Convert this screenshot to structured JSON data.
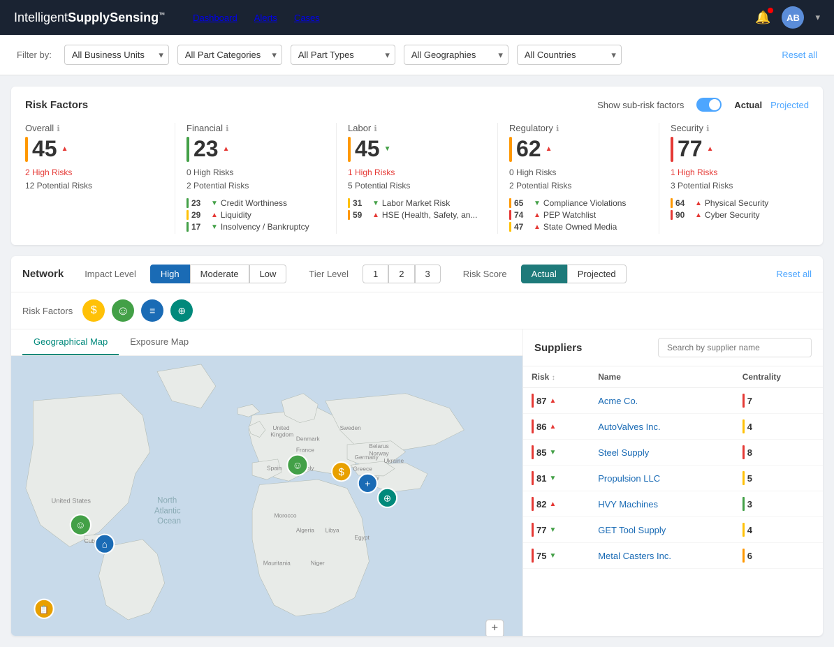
{
  "brand": {
    "name_light": "Intelligent",
    "name_bold": "SupplySensing",
    "tm": "™"
  },
  "nav": {
    "items": [
      {
        "label": "Dashboard",
        "active": true
      },
      {
        "label": "Alerts",
        "active": false
      },
      {
        "label": "Cases",
        "active": false
      }
    ]
  },
  "user": {
    "initials": "AB"
  },
  "filter_bar": {
    "label": "Filter by:",
    "filters": [
      {
        "id": "business-units",
        "value": "All Business Units"
      },
      {
        "id": "part-categories",
        "value": "All Part Categories"
      },
      {
        "id": "part-types",
        "value": "All Part Types"
      },
      {
        "id": "geographies",
        "value": "All Geographies"
      },
      {
        "id": "countries",
        "value": "All Countries"
      }
    ],
    "reset_label": "Reset all"
  },
  "risk_factors": {
    "title": "Risk Factors",
    "show_sub_label": "Show sub-risk factors",
    "actual_label": "Actual",
    "projected_label": "Projected",
    "columns": [
      {
        "id": "overall",
        "title": "Overall",
        "score": "45",
        "trend": "up",
        "bar_color": "orange",
        "high_risks": "2 High Risks",
        "potential_risks": "12 Potential Risks",
        "sub_items": []
      },
      {
        "id": "financial",
        "title": "Financial",
        "score": "23",
        "trend": "up",
        "bar_color": "green",
        "high_risks": "0 High Risks",
        "potential_risks": "2 Potential Risks",
        "sub_items": [
          {
            "score": "23",
            "trend": "down",
            "label": "Credit Worthiness",
            "bar_color": "green"
          },
          {
            "score": "29",
            "trend": "up",
            "label": "Liquidity",
            "bar_color": "yellow"
          },
          {
            "score": "17",
            "trend": "down",
            "label": "Insolvency / Bankruptcy",
            "bar_color": "green"
          }
        ]
      },
      {
        "id": "labor",
        "title": "Labor",
        "score": "45",
        "trend": "down",
        "bar_color": "orange",
        "high_risks": "1 High Risks",
        "potential_risks": "5 Potential Risks",
        "sub_items": [
          {
            "score": "31",
            "trend": "down",
            "label": "Labor Market Risk",
            "bar_color": "yellow"
          },
          {
            "score": "59",
            "trend": "up",
            "label": "HSE (Health, Safety, an...",
            "bar_color": "orange"
          },
          {
            "score": "",
            "trend": "",
            "label": "",
            "bar_color": ""
          }
        ]
      },
      {
        "id": "regulatory",
        "title": "Regulatory",
        "score": "62",
        "trend": "up",
        "bar_color": "orange",
        "high_risks": "0 High Risks",
        "potential_risks": "2 Potential Risks",
        "sub_items": [
          {
            "score": "65",
            "trend": "down",
            "label": "Compliance Violations",
            "bar_color": "orange"
          },
          {
            "score": "74",
            "trend": "up",
            "label": "PEP Watchlist",
            "bar_color": "red"
          },
          {
            "score": "47",
            "trend": "up",
            "label": "State Owned Media",
            "bar_color": "yellow"
          }
        ]
      },
      {
        "id": "security",
        "title": "Security",
        "score": "77",
        "trend": "up",
        "bar_color": "red",
        "high_risks": "1 High Risks",
        "potential_risks": "3 Potential Risks",
        "sub_items": [
          {
            "score": "64",
            "trend": "up",
            "label": "Physical Security",
            "bar_color": "orange"
          },
          {
            "score": "90",
            "trend": "up",
            "label": "Cyber Security",
            "bar_color": "red"
          }
        ]
      }
    ]
  },
  "network": {
    "title": "Network",
    "impact_label": "Impact Level",
    "impact_btns": [
      {
        "label": "High",
        "active": true
      },
      {
        "label": "Moderate",
        "active": false
      },
      {
        "label": "Low",
        "active": false
      }
    ],
    "tier_label": "Tier Level",
    "tier_btns": [
      {
        "label": "1",
        "active": false
      },
      {
        "label": "2",
        "active": false
      },
      {
        "label": "3",
        "active": false
      }
    ],
    "risk_score_label": "Risk Score",
    "risk_score_btns": [
      {
        "label": "Actual",
        "active": true
      },
      {
        "label": "Projected",
        "active": false
      }
    ],
    "reset_label": "Reset all"
  },
  "risk_factor_icons": {
    "label": "Risk Factors",
    "icons": [
      {
        "symbol": "$",
        "color": "yellow",
        "name": "financial-icon"
      },
      {
        "symbol": "☺",
        "color": "green",
        "name": "labor-icon"
      },
      {
        "symbol": "≡",
        "color": "blue",
        "name": "regulatory-icon"
      },
      {
        "symbol": "⊕",
        "color": "teal",
        "name": "security-icon"
      }
    ]
  },
  "map_tabs": [
    {
      "label": "Geographical Map",
      "active": true
    },
    {
      "label": "Exposure Map",
      "active": false
    }
  ],
  "suppliers": {
    "title": "Suppliers",
    "search_placeholder": "Search by supplier name",
    "col_risk": "Risk",
    "col_name": "Name",
    "col_centrality": "Centrality",
    "rows": [
      {
        "risk": 87,
        "trend": "up",
        "bar_color": "red",
        "name": "Acme Co.",
        "centrality": 7,
        "cen_color": "red"
      },
      {
        "risk": 86,
        "trend": "up",
        "bar_color": "red",
        "name": "AutoValves Inc.",
        "centrality": 4,
        "cen_color": "yellow"
      },
      {
        "risk": 85,
        "trend": "down",
        "bar_color": "red",
        "name": "Steel Supply",
        "centrality": 8,
        "cen_color": "red"
      },
      {
        "risk": 81,
        "trend": "down",
        "bar_color": "red",
        "name": "Propulsion LLC",
        "centrality": 5,
        "cen_color": "yellow"
      },
      {
        "risk": 82,
        "trend": "up",
        "bar_color": "red",
        "name": "HVY Machines",
        "centrality": 3,
        "cen_color": "green"
      },
      {
        "risk": 77,
        "trend": "down",
        "bar_color": "red",
        "name": "GET Tool Supply",
        "centrality": 4,
        "cen_color": "yellow"
      },
      {
        "risk": 75,
        "trend": "down",
        "bar_color": "red",
        "name": "Metal Casters Inc.",
        "centrality": 6,
        "cen_color": "orange"
      }
    ]
  }
}
